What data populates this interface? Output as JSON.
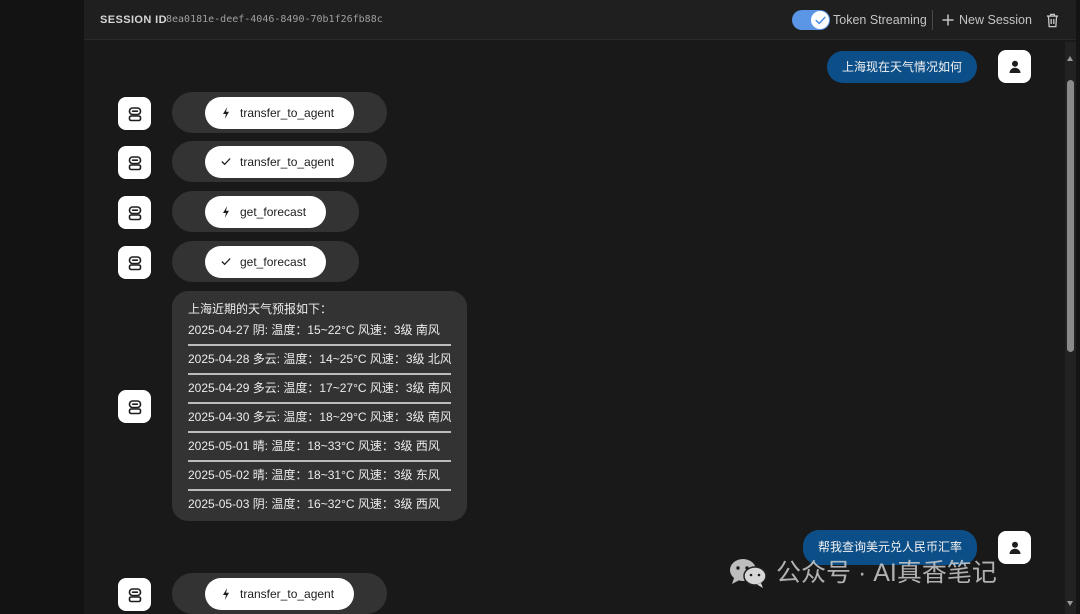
{
  "colors": {
    "user_bubble": "#0c4f88",
    "agent_bubble": "#333333",
    "toggle_on": "#5b95e6",
    "chat_background": "#191919",
    "header_background": "#1f1f1f"
  },
  "header": {
    "session_label": "SESSION ID",
    "session_id": "8ea0181e-deef-4046-8490-70b1f26fb88c",
    "token_streaming": {
      "label": "Token Streaming",
      "enabled": true,
      "icon": "check-icon"
    },
    "new_session": {
      "label": "New Session",
      "icon": "plus-icon"
    },
    "delete_session": {
      "icon": "trash-icon"
    }
  },
  "messages": [
    {
      "avatar_icon": "person-icon",
      "text": "上海现在天气情况如何"
    },
    {
      "avatar_icon": "robot-icon",
      "status_icon": "lightning-icon",
      "tool": "transfer_to_agent"
    },
    {
      "avatar_icon": "robot-icon",
      "status_icon": "check-icon",
      "tool": "transfer_to_agent"
    },
    {
      "avatar_icon": "robot-icon",
      "status_icon": "lightning-icon",
      "tool": "get_forecast"
    },
    {
      "avatar_icon": "robot-icon",
      "status_icon": "check-icon",
      "tool": "get_forecast"
    },
    {
      "avatar_icon": "robot-icon",
      "intro": "上海近期的天气预报如下：",
      "forecast": [
        "2025-04-27 阴: 温度：15~22°C 风速：3级 南风",
        "2025-04-28 多云: 温度：14~25°C 风速：3级 北风",
        "2025-04-29 多云: 温度：17~27°C 风速：3级 南风",
        "2025-04-30 多云: 温度：18~29°C 风速：3级 南风",
        "2025-05-01 晴: 温度：18~33°C 风速：3级 西风",
        "2025-05-02 晴: 温度：18~31°C 风速：3级 东风",
        "2025-05-03 阴: 温度：16~32°C 风速：3级 西风"
      ]
    },
    {
      "avatar_icon": "person-icon",
      "text": "帮我查询美元兑人民币汇率"
    },
    {
      "avatar_icon": "robot-icon",
      "status_icon": "lightning-icon",
      "tool": "transfer_to_agent"
    }
  ],
  "watermark": {
    "icon": "wechat-icon",
    "text": "公众号 · AI真香笔记"
  }
}
